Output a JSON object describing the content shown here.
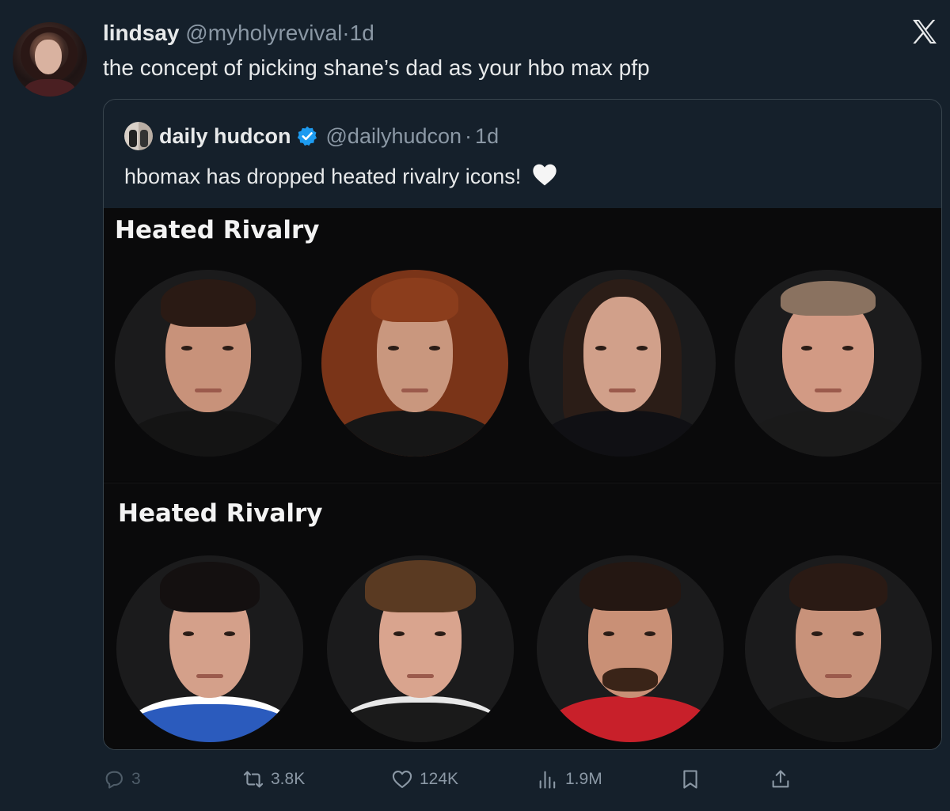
{
  "tweet": {
    "author_name": "lindsay",
    "author_handle": "@myholyrevival",
    "separator": "·",
    "time": "1d",
    "text": "the concept of picking shane’s dad as your hbo max pfp"
  },
  "quoted_tweet": {
    "author_name": "daily hudcon",
    "author_handle": "@dailyhudcon",
    "separator": "·",
    "time": "1d",
    "text": "hbomax has dropped heated rivalry icons!",
    "verified": true,
    "emoji_icon": "white-heart-icon"
  },
  "media": {
    "sections": [
      {
        "title": "Heated Rivalry",
        "portraits": [
          {
            "name": "portrait-man-dark-hair",
            "skin": "#c8927a",
            "hair": "#2a1a14",
            "body": "#141414"
          },
          {
            "name": "portrait-woman-curly-hair",
            "skin": "#c9977e",
            "hair": "#7a3418",
            "body": "#161616"
          },
          {
            "name": "portrait-woman-long-hair",
            "skin": "#d1a08a",
            "hair": "#2b1d17",
            "body": "#101014"
          },
          {
            "name": "portrait-older-man",
            "skin": "#d29a84",
            "hair": "#8a7260",
            "body": "#1a1a1a"
          }
        ]
      },
      {
        "title": "Heated Rivalry",
        "portraits": [
          {
            "name": "portrait-young-man-jersey",
            "skin": "#d4a08a",
            "hair": "#141010",
            "body": "#2b5bbd"
          },
          {
            "name": "portrait-young-man-curly",
            "skin": "#d9a48e",
            "hair": "#5a3a22",
            "body": "#1a1a1a"
          },
          {
            "name": "portrait-bearded-man-jersey",
            "skin": "#c99076",
            "hair": "#241712",
            "body": "#c8202a"
          },
          {
            "name": "portrait-man-smiling",
            "skin": "#c8927a",
            "hair": "#2a1a14",
            "body": "#141414"
          }
        ]
      }
    ]
  },
  "actions": {
    "replies": "3",
    "retweets": "3.8K",
    "likes": "124K",
    "views": "1.9M"
  },
  "icons": {
    "x_logo": "x-logo-icon",
    "reply": "reply-icon",
    "retweet": "retweet-icon",
    "like": "heart-icon",
    "views": "views-icon",
    "bookmark": "bookmark-icon",
    "share": "share-icon"
  }
}
